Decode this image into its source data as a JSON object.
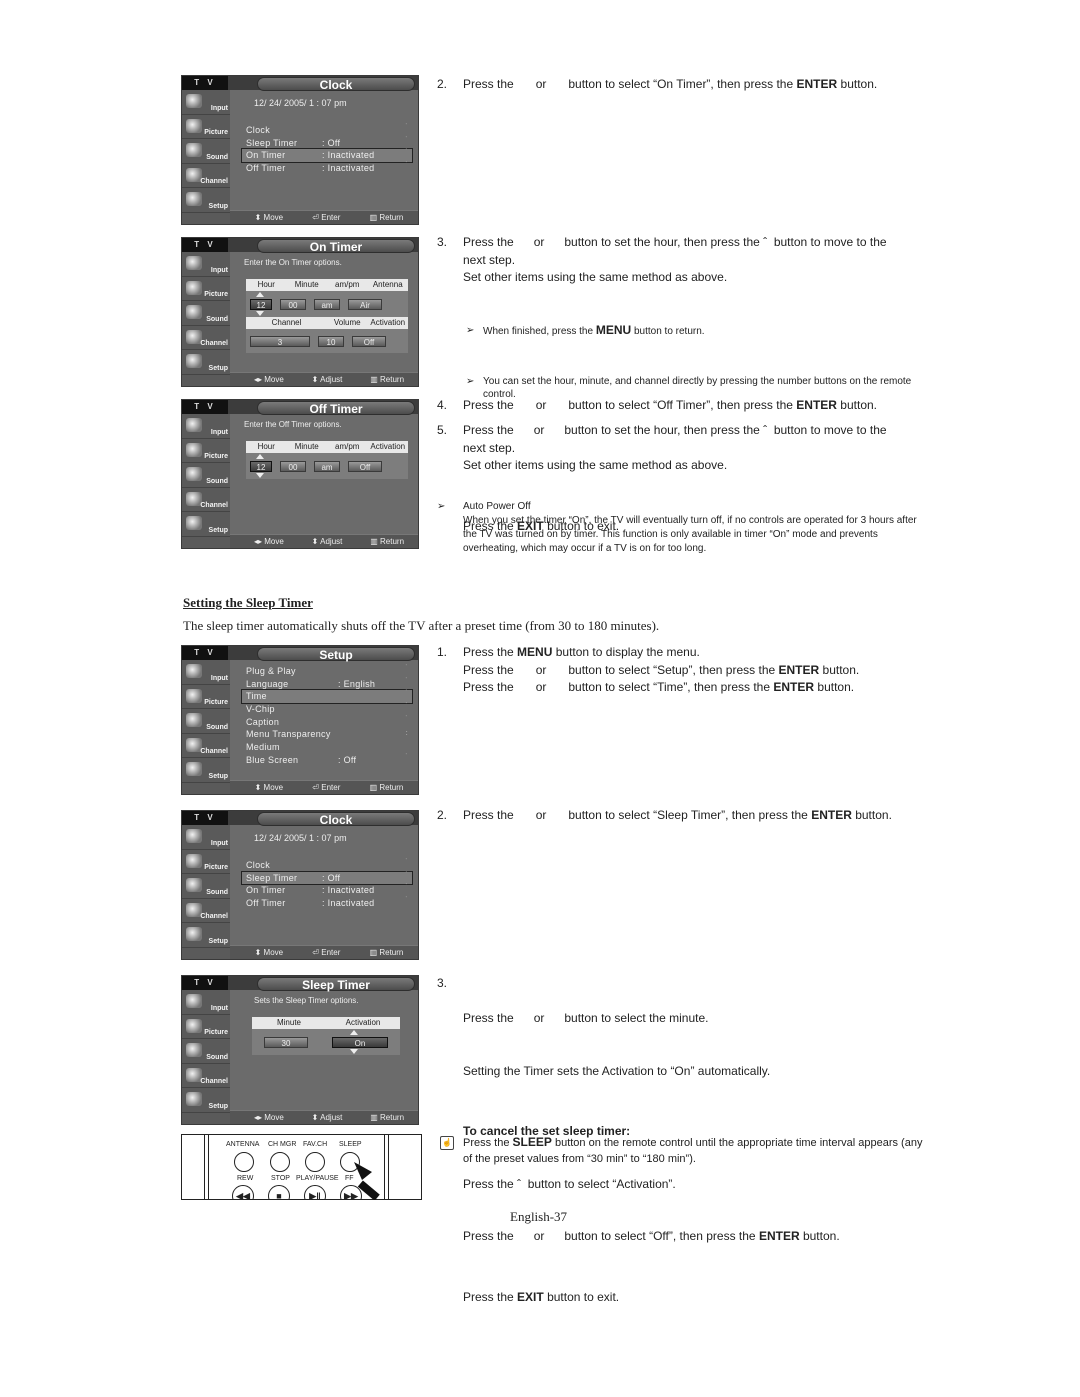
{
  "osd_common": {
    "tv_label": "T V",
    "sidebar": [
      "Input",
      "Picture",
      "Sound",
      "Channel",
      "Setup"
    ],
    "footer_enter": [
      "Move",
      "Enter",
      "Return"
    ],
    "footer_adjust": [
      "Move",
      "Adjust",
      "Return"
    ]
  },
  "screen_clock_on": {
    "title": "Clock",
    "date": "12/ 24/ 2005/ 1 : 07 pm",
    "rows": [
      {
        "label": "Clock",
        "value": ""
      },
      {
        "label": "Sleep Timer",
        "value": ": Off"
      },
      {
        "label": "On Timer",
        "value": ": Inactivated"
      },
      {
        "label": "Off Timer",
        "value": ": Inactivated"
      }
    ],
    "selected_index": 2
  },
  "screen_on_timer": {
    "title": "On Timer",
    "subtitle": "Enter the On  Timer options.",
    "head1": [
      "Hour",
      "Minute",
      "am/pm",
      "Antenna"
    ],
    "vals1": [
      "12",
      "00",
      "am",
      "Air"
    ],
    "head2": [
      "Channel",
      "Volume",
      "Activation"
    ],
    "vals2": [
      "3",
      "10",
      "Off"
    ]
  },
  "screen_off_timer": {
    "title": "Off Timer",
    "subtitle": "Enter the Off  Timer options.",
    "head": [
      "Hour",
      "Minute",
      "am/pm",
      "Activation"
    ],
    "vals": [
      "12",
      "00",
      "am",
      "Off"
    ]
  },
  "screen_setup": {
    "title": "Setup",
    "rows": [
      {
        "label": "Plug & Play",
        "value": ""
      },
      {
        "label": "Language",
        "value": ": English"
      },
      {
        "label": "Time",
        "value": ""
      },
      {
        "label": "V-Chip",
        "value": ""
      },
      {
        "label": "Caption",
        "value": ""
      },
      {
        "label": "Menu Transparency",
        "value": ":"
      },
      {
        "label": "Medium",
        "value": ""
      },
      {
        "label": "Blue Screen",
        "value": ": Off"
      }
    ],
    "selected_index": 2
  },
  "screen_clock_sleep": {
    "title": "Clock",
    "date": "12/ 24/ 2005/ 1 : 07 pm",
    "rows": [
      {
        "label": "Clock",
        "value": ""
      },
      {
        "label": "Sleep Timer",
        "value": ": Off"
      },
      {
        "label": "On Timer",
        "value": ": Inactivated"
      },
      {
        "label": "Off Timer",
        "value": ": Inactivated"
      }
    ],
    "selected_index": 1
  },
  "screen_sleep_timer": {
    "title": "Sleep Timer",
    "subtitle": "Sets the Sleep Timer options.",
    "head": [
      "Minute",
      "Activation"
    ],
    "vals": [
      "30",
      "On"
    ]
  },
  "remote": {
    "top_labels": [
      "ANTENNA",
      "CH MGR",
      "FAV.CH",
      "SLEEP"
    ],
    "bottom_labels": [
      "REW",
      "STOP",
      "PLAY/PAUSE",
      "FF"
    ]
  },
  "steps_on_off": {
    "s2": {
      "num": "2.",
      "pre": "Press the",
      "or": "or",
      "post": "button to select “On Timer”, then press the",
      "bold": "ENTER",
      "end": "button."
    },
    "s3": {
      "num": "3.",
      "line1": "Press the      or      button to set the hour, then press the ˆ  button to move to the",
      "line2": "next step.",
      "line3": "Set other items using the same method as above.",
      "note1_pre": "When finished, press the",
      "note1_bold": "MENU",
      "note1_post": "button to return.",
      "note2": "You can set the hour, minute, and channel directly by pressing the number buttons on the remote control."
    },
    "s4": {
      "num": "4.",
      "pre": "Press the",
      "or": "or",
      "post": "button to select “Off Timer”, then press the",
      "bold": "ENTER",
      "end": "button."
    },
    "s5": {
      "num": "5.",
      "line1": "Press the      or      button to set the hour, then press the ˆ  button to move to the",
      "line2": "next step.",
      "line3": "Set other items using the same method as above.",
      "exit_pre": "Press the",
      "exit_bold": "EXIT",
      "exit_post": "button to exit."
    },
    "auto_power": {
      "title": "Auto Power Off",
      "body": "When you set the timer “On”, the TV will eventually turn off, if no controls are operated for 3 hours after the TV was turned on by timer. This function is only available in timer “On” mode and prevents overheating, which may occur if a TV is on for too long."
    }
  },
  "sleep_section": {
    "heading": "Setting the Sleep Timer",
    "description": "The sleep timer automatically shuts off the TV after a preset time (from 30 to 180 minutes).",
    "s1": {
      "num": "1.",
      "l1_pre": "Press the",
      "l1_bold": "MENU",
      "l1_post": "button to display the menu.",
      "l2_pre": "Press the",
      "l2_or": "or",
      "l2_post": "button to select “Setup”, then press the",
      "l2_bold": "ENTER",
      "l2_end": "button.",
      "l3_pre": "Press the",
      "l3_or": "or",
      "l3_post": "button to select “Time”, then press the",
      "l3_bold": "ENTER",
      "l3_end": "button."
    },
    "s2": {
      "num": "2.",
      "pre": "Press the",
      "or": "or",
      "post": "button to select “Sleep Timer”, then press the",
      "bold": "ENTER",
      "end": "button."
    },
    "s3": {
      "num": "3.",
      "l1": "Press the      or      button to select the minute.",
      "l2": "Setting the Timer sets the Activation to “On” automatically.",
      "cancel_heading": "To cancel the set sleep timer:",
      "c1": "Press the ˆ  button to select “Activation”.",
      "c2_pre": "Press the      or      button to select “Off”, then press the",
      "c2_bold": "ENTER",
      "c2_end": "button.",
      "exit_pre": "Press the",
      "exit_bold": "EXIT",
      "exit_post": "button to exit."
    },
    "sleep_note_pre": "Press the",
    "sleep_note_bold": "SLEEP",
    "sleep_note_post": "button on the remote control until the appropriate time interval appears (any of the preset values from “30 min” to “180 min”)."
  },
  "page_number": "English-37"
}
